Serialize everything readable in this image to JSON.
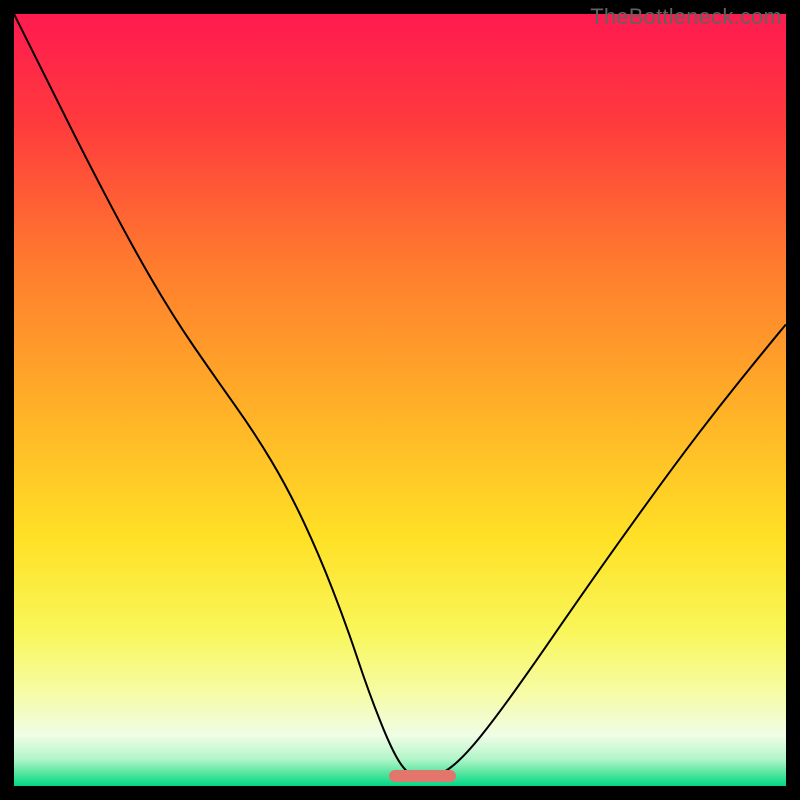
{
  "watermark": {
    "text": "TheBottleneck.com"
  },
  "gradient": {
    "stops": [
      {
        "pct": 0,
        "color": "#ff1a50"
      },
      {
        "pct": 14,
        "color": "#ff3a3d"
      },
      {
        "pct": 32,
        "color": "#ff7a2e"
      },
      {
        "pct": 52,
        "color": "#ffb327"
      },
      {
        "pct": 68,
        "color": "#ffe126"
      },
      {
        "pct": 80,
        "color": "#f9f65a"
      },
      {
        "pct": 88,
        "color": "#f6fca6"
      },
      {
        "pct": 93.5,
        "color": "#effde6"
      },
      {
        "pct": 96.5,
        "color": "#b2f5c9"
      },
      {
        "pct": 98.3,
        "color": "#57e6a0"
      },
      {
        "pct": 100,
        "color": "#00d884"
      }
    ]
  },
  "marker": {
    "color": "#e2766d",
    "x_start": 0.486,
    "x_end": 0.572,
    "y": 0.987
  },
  "curve": {
    "stroke": "#000000",
    "width": 2
  },
  "chart_data": {
    "type": "line",
    "title": "",
    "xlabel": "",
    "ylabel": "",
    "xlim": [
      0,
      1
    ],
    "ylim": [
      0,
      1
    ],
    "note": "No numeric axes are shown; x and y are normalized 0–1 in plot coordinates (y=1 at top). Values eyeballed from the image.",
    "series": [
      {
        "name": "bottleneck-curve",
        "points": [
          {
            "x": 0.0,
            "y": 1.0
          },
          {
            "x": 0.045,
            "y": 0.91
          },
          {
            "x": 0.095,
            "y": 0.81
          },
          {
            "x": 0.15,
            "y": 0.705
          },
          {
            "x": 0.205,
            "y": 0.61
          },
          {
            "x": 0.26,
            "y": 0.53
          },
          {
            "x": 0.31,
            "y": 0.46
          },
          {
            "x": 0.355,
            "y": 0.385
          },
          {
            "x": 0.395,
            "y": 0.3
          },
          {
            "x": 0.43,
            "y": 0.21
          },
          {
            "x": 0.46,
            "y": 0.12
          },
          {
            "x": 0.49,
            "y": 0.045
          },
          {
            "x": 0.51,
            "y": 0.015
          },
          {
            "x": 0.53,
            "y": 0.01
          },
          {
            "x": 0.555,
            "y": 0.015
          },
          {
            "x": 0.585,
            "y": 0.04
          },
          {
            "x": 0.625,
            "y": 0.09
          },
          {
            "x": 0.675,
            "y": 0.16
          },
          {
            "x": 0.73,
            "y": 0.24
          },
          {
            "x": 0.79,
            "y": 0.325
          },
          {
            "x": 0.855,
            "y": 0.415
          },
          {
            "x": 0.92,
            "y": 0.5
          },
          {
            "x": 0.985,
            "y": 0.58
          },
          {
            "x": 1.0,
            "y": 0.598
          }
        ]
      }
    ],
    "marker_region": {
      "x_start": 0.486,
      "x_end": 0.572,
      "y": 0.013
    }
  }
}
